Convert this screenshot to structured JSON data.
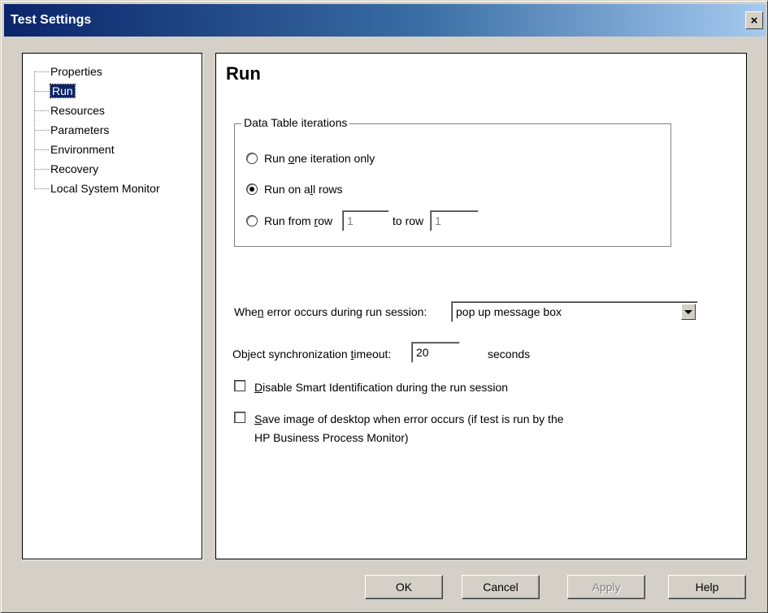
{
  "window": {
    "title": "Test Settings",
    "close_glyph": "×"
  },
  "tree": {
    "items": [
      {
        "label": "Properties"
      },
      {
        "label": "Run"
      },
      {
        "label": "Resources"
      },
      {
        "label": "Parameters"
      },
      {
        "label": "Environment"
      },
      {
        "label": "Recovery"
      },
      {
        "label": "Local System Monitor"
      }
    ],
    "selected": "Run"
  },
  "run": {
    "title": "Run",
    "iterations_group": {
      "title": "Data Table iterations",
      "options": [
        {
          "pre": "Run ",
          "ul": "o",
          "post": "ne iteration only",
          "checked": false
        },
        {
          "pre": "Run on a",
          "ul": "l",
          "post": "l rows",
          "checked": true
        },
        {
          "pre": "Run from ",
          "ul": "r",
          "post": "ow",
          "checked": false
        }
      ],
      "from_row": "1",
      "to_row_label": "to row",
      "to_row": "1"
    },
    "error_label_pre": "Whe",
    "error_label_ul": "n",
    "error_label_post": " error occurs during run session:",
    "error_value": "pop up message box",
    "sync_label_pre": "Object synchronization ",
    "sync_label_ul": "t",
    "sync_label_post": "imeout:",
    "sync_value": "20",
    "sync_unit": "seconds",
    "disable_smart_ul": "D",
    "disable_smart_post": "isable Smart Identification during the run session",
    "save_image_ul": "S",
    "save_image_post_line1": "ave image of desktop when error occurs (if test is run by the",
    "save_image_line2": "HP Business Process Monitor)"
  },
  "buttons": {
    "ok": "OK",
    "cancel": "Cancel",
    "apply": "Apply",
    "help": "Help"
  }
}
